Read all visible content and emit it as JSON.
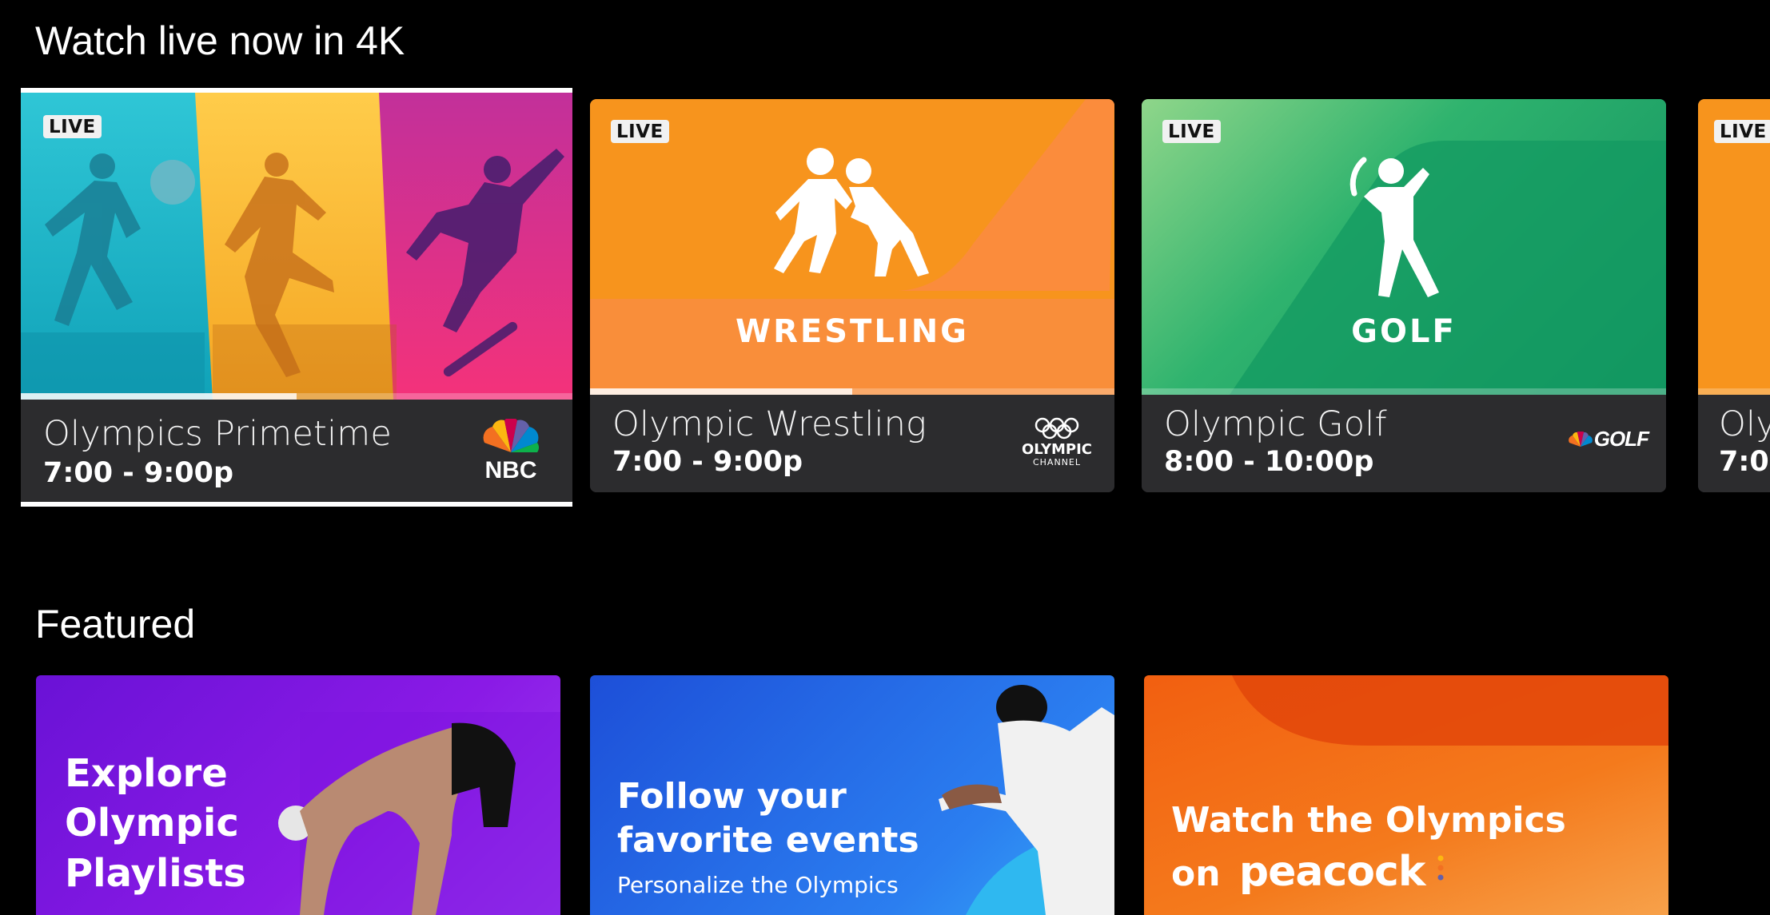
{
  "sections": {
    "live_title": "Watch live now in 4K",
    "featured_title": "Featured"
  },
  "live_cards": [
    {
      "badge": "LIVE",
      "title": "Olympics Primetime",
      "time": "7:00 - 9:00p",
      "network": "NBC",
      "progress": 0.5,
      "focused": true
    },
    {
      "badge": "LIVE",
      "title": "Olympic Wrestling",
      "time": "7:00 - 9:00p",
      "art_label": "WRESTLING",
      "network": "OLYMPIC",
      "network_sub": "CHANNEL",
      "progress": 0.5
    },
    {
      "badge": "LIVE",
      "title": "Olympic Golf",
      "time": "8:00 - 10:00p",
      "art_label": "GOLF",
      "network": "GOLF",
      "progress": 0.0
    },
    {
      "badge": "LIVE",
      "title": "Oly",
      "time": "7:0"
    }
  ],
  "featured": [
    {
      "lines": [
        "Explore",
        "Olympic",
        "Playlists"
      ]
    },
    {
      "lines": [
        "Follow your",
        "favorite events"
      ],
      "sub": "Personalize the Olympics"
    },
    {
      "lines": [
        "Watch the Olympics",
        "on"
      ],
      "brand": "peacock"
    }
  ],
  "colors": {
    "background": "#000000",
    "card_info": "#2c2c2e",
    "wrestling_orange": "#f7941d",
    "golf_green": "#16a866",
    "focus_outline": "#ffffff"
  }
}
